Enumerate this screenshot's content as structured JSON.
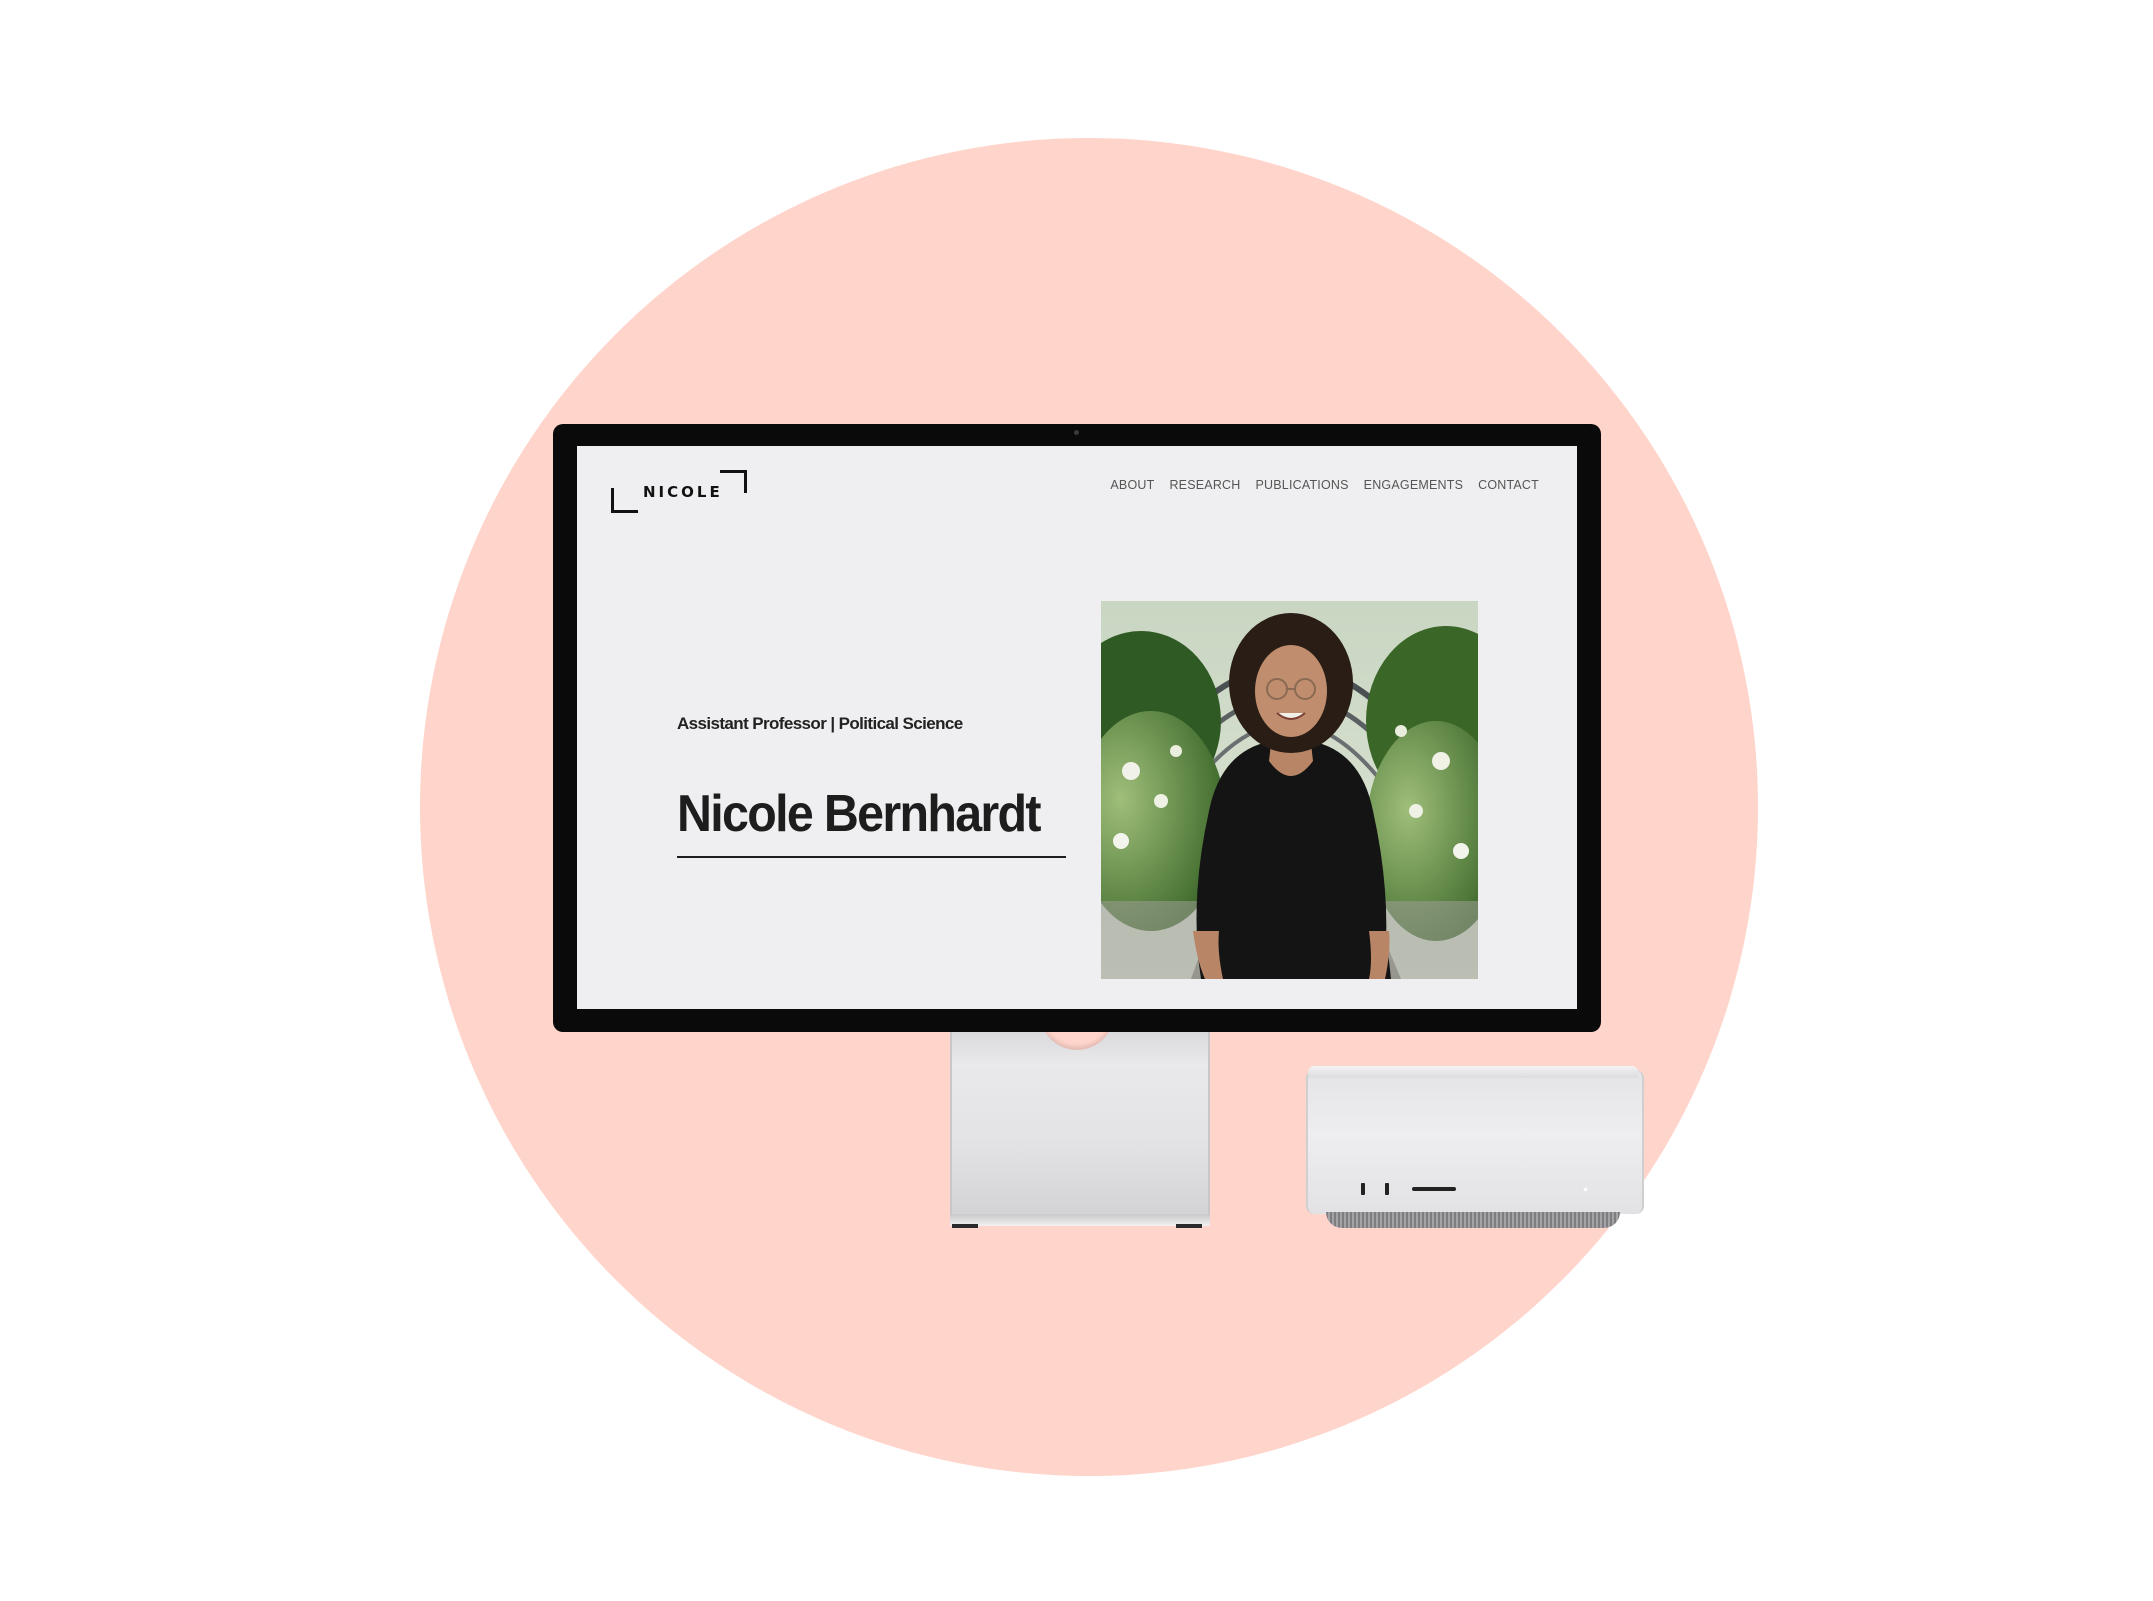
{
  "colors": {
    "background": "#ffffff",
    "circle": "#ffd4ca",
    "screen_bg": "#efeff1",
    "text_dark": "#1d1d1d",
    "nav_text": "#555555"
  },
  "site": {
    "logo_text": "NICOLE",
    "nav": {
      "items": [
        {
          "label": "ABOUT"
        },
        {
          "label": "RESEARCH"
        },
        {
          "label": "PUBLICATIONS"
        },
        {
          "label": "ENGAGEMENTS"
        },
        {
          "label": "CONTACT"
        }
      ]
    },
    "hero": {
      "subtitle": "Assistant Professor | Political Science",
      "name": "Nicole Bernhardt"
    }
  },
  "icons": {
    "logo": "bracket-corners-logo",
    "camera": "camera-dot-icon"
  }
}
